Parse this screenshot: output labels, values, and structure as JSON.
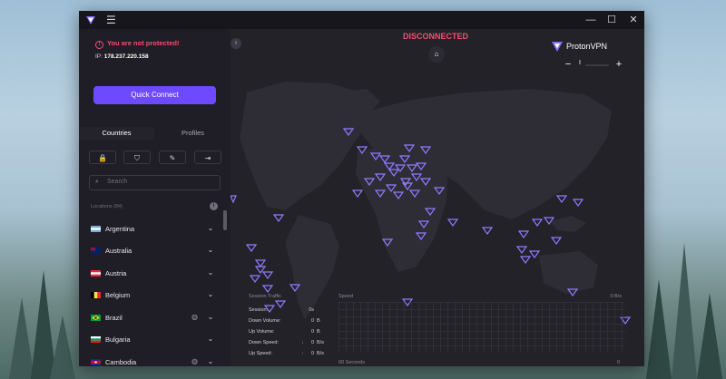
{
  "window": {
    "minimize": "—",
    "maximize": "☐",
    "close": "✕",
    "menu": "☰"
  },
  "sidebar": {
    "warning": "You are not protected!",
    "ip_label": "IP:",
    "ip_value": "178.237.220.158",
    "quick_connect": "Quick Connect",
    "tabs": [
      "Countries",
      "Profiles"
    ],
    "filters": [
      "🔒",
      "⛉",
      "✎",
      "⇥"
    ],
    "search_placeholder": "Search",
    "locations_header": "Locations (84)",
    "countries": [
      {
        "name": "Argentina",
        "has_globe": false
      },
      {
        "name": "Australia",
        "has_globe": false
      },
      {
        "name": "Austria",
        "has_globe": false
      },
      {
        "name": "Belgium",
        "has_globe": false
      },
      {
        "name": "Brazil",
        "has_globe": true
      },
      {
        "name": "Bulgaria",
        "has_globe": false
      },
      {
        "name": "Cambodia",
        "has_globe": true
      }
    ]
  },
  "map": {
    "status": "DISCONNECTED",
    "brand": "ProtonVPN",
    "zoom_minus": "−",
    "zoom_plus": "+",
    "zoom_level": "I",
    "session": {
      "title": "Session Traffic",
      "rows": [
        {
          "label": "Session:",
          "value": "0s",
          "unit": ""
        },
        {
          "label": "Down Volume:",
          "value": "0",
          "unit": "B"
        },
        {
          "label": "Up Volume:",
          "value": "0",
          "unit": "B"
        },
        {
          "label": "Down Speed:",
          "value": "0",
          "unit": "B/s"
        },
        {
          "label": "Up Speed:",
          "value": "0",
          "unit": "B/s"
        }
      ]
    },
    "speed": {
      "title": "Speed",
      "max": "0 B/s",
      "xlabel": "60 Seconds",
      "xmax": "0"
    }
  },
  "colors": {
    "accent": "#6d4aff",
    "danger": "#f0506e",
    "pin": "#8f7bff"
  }
}
